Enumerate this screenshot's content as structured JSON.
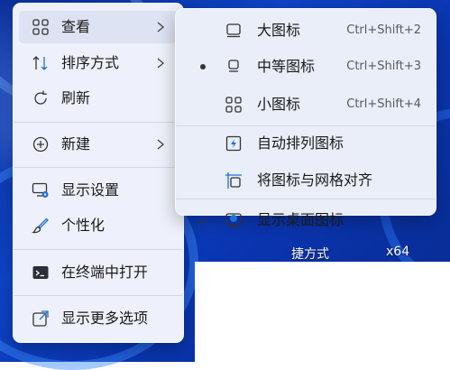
{
  "main_menu": {
    "items": [
      {
        "label": "查看",
        "icon": "grid-icon"
      },
      {
        "label": "排序方式",
        "icon": "sort-icon"
      },
      {
        "label": "刷新",
        "icon": "refresh-icon"
      },
      {
        "label": "新建",
        "icon": "add-circle-icon"
      },
      {
        "label": "显示设置",
        "icon": "display-settings-icon"
      },
      {
        "label": "个性化",
        "icon": "brush-icon"
      },
      {
        "label": "在终端中打开",
        "icon": "terminal-icon"
      },
      {
        "label": "显示更多选项",
        "icon": "open-external-icon"
      }
    ]
  },
  "sub_menu": {
    "items": [
      {
        "label": "大图标",
        "shortcut": "Ctrl+Shift+2",
        "icon": "large-icon-view-icon"
      },
      {
        "label": "中等图标",
        "shortcut": "Ctrl+Shift+3",
        "icon": "medium-icon-view-icon",
        "selected": true
      },
      {
        "label": "小图标",
        "shortcut": "Ctrl+Shift+4",
        "icon": "small-icon-view-icon"
      },
      {
        "label": "自动排列图标",
        "icon": "auto-arrange-icon"
      },
      {
        "label": "将图标与网格对齐",
        "icon": "align-grid-icon"
      },
      {
        "label": "显示桌面图标",
        "icon": "show-desktop-icon",
        "checked": true
      }
    ]
  },
  "desktop": {
    "label_left": "捷方式",
    "label_right": "x64"
  },
  "colors": {
    "accent": "#1f6fd8",
    "menu_bg": "#eef1fb",
    "wallpaper": "#0e44c8"
  }
}
